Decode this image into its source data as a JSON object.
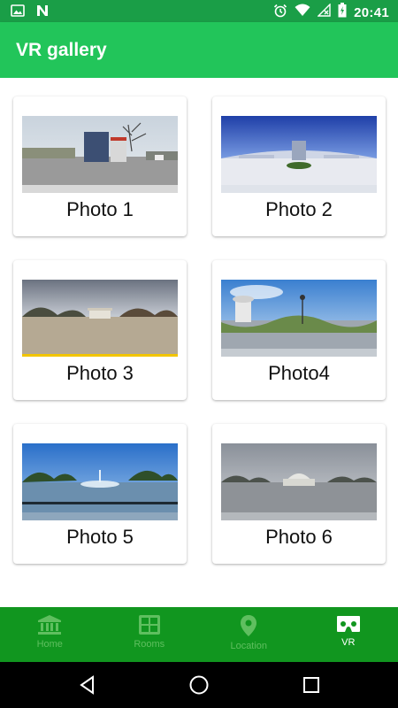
{
  "status_bar": {
    "time": "20:41",
    "icons": [
      "image-icon",
      "n-app-icon",
      "alarm-icon",
      "wifi-icon",
      "signal-icon",
      "battery-charging-icon"
    ]
  },
  "app_bar": {
    "title": "VR gallery"
  },
  "gallery": {
    "items": [
      {
        "label": "Photo 1"
      },
      {
        "label": "Photo 2"
      },
      {
        "label": "Photo 3"
      },
      {
        "label": "Photo4"
      },
      {
        "label": "Photo 5"
      },
      {
        "label": "Photo 6"
      }
    ]
  },
  "bottom_nav": {
    "items": [
      {
        "label": "Home",
        "icon": "bank-icon",
        "active": false
      },
      {
        "label": "Rooms",
        "icon": "grid-icon",
        "active": false
      },
      {
        "label": "Location",
        "icon": "location-pin-icon",
        "active": false
      },
      {
        "label": "VR",
        "icon": "vr-headset-icon",
        "active": true
      }
    ]
  },
  "colors": {
    "status_bar": "#1a9e47",
    "app_bar": "#22c55a",
    "bottom_nav": "#11961f",
    "nav_inactive": "#5fbf5f",
    "nav_active": "#ffffff"
  }
}
